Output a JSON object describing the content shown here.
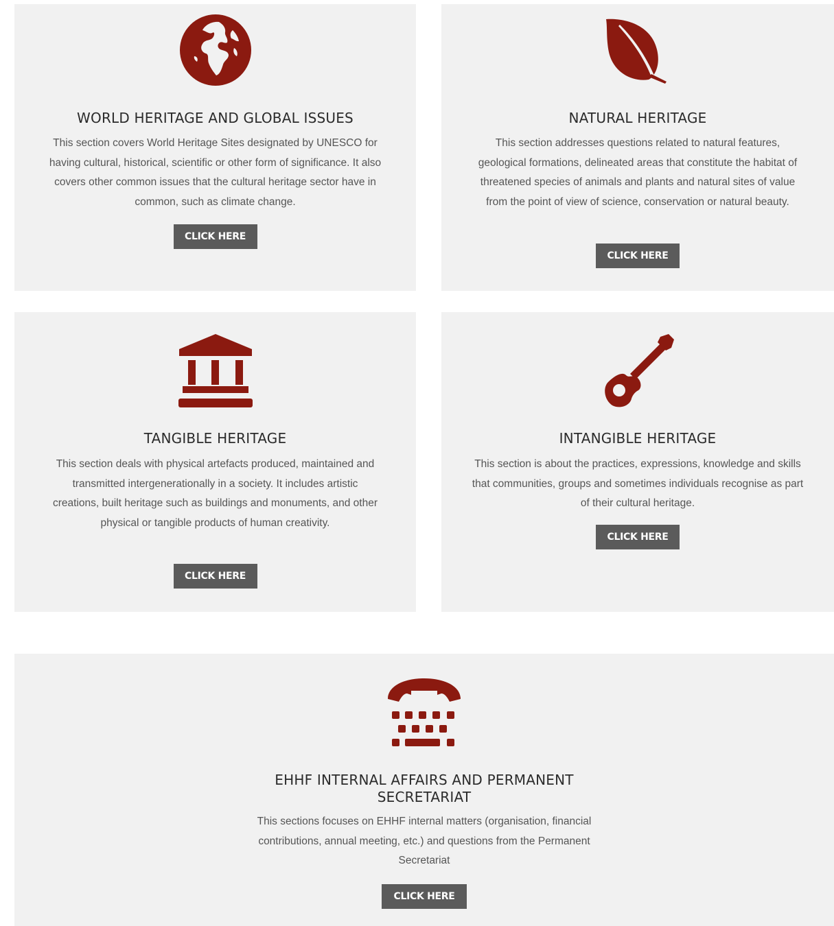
{
  "accent_color": "#8b1a10",
  "button_color": "#5b5b5b",
  "cards": [
    {
      "icon": "globe-icon",
      "title": "WORLD HERITAGE AND GLOBAL ISSUES",
      "description": "This section covers World Heritage Sites  designated by UNESCO for having cultural, historical, scientific or other form of significance. It also covers other common issues that the cultural heritage sector have in common, such as climate change.",
      "button": "CLICK HERE"
    },
    {
      "icon": "leaf-icon",
      "title": "NATURAL HERITAGE",
      "description": "This section addresses questions related to  natural features, geological formations, delineated areas that constitute the habitat of threatened species of animals and plants and natural sites of value from the point of view of science, conservation or natural beauty.",
      "button": "CLICK HERE"
    },
    {
      "icon": "museum-icon",
      "title": "TANGIBLE HERITAGE",
      "description": "This section deals with physical artefacts produced, maintained and transmitted intergenerationally in a society. It includes artistic creations, built heritage such as buildings and monuments, and other physical or tangible products of human creativity.",
      "button": "CLICK HERE"
    },
    {
      "icon": "guitar-icon",
      "title": "INTANGIBLE HERITAGE",
      "description": "This section is about the practices, expressions, knowledge and skills that communities, groups and sometimes individuals recognise as part of their cultural heritage.",
      "button": "CLICK HERE"
    },
    {
      "icon": "telephone-icon",
      "title_line1": "EHHF INTERNAL AFFAIRS AND PERMANENT",
      "title_line2": "SECRETARIAT",
      "description": "This sections focuses on EHHF internal matters (organisation, financial contributions, annual meeting, etc.) and questions from the Permanent Secretariat",
      "button": "CLICK HERE"
    }
  ]
}
